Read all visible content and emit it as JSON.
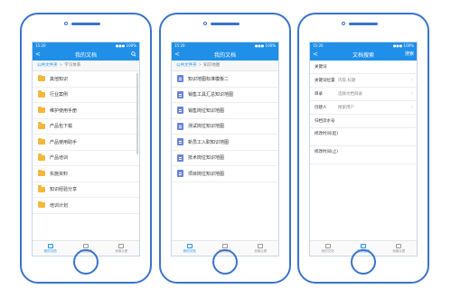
{
  "status_bar": {
    "left": "15:20",
    "right": "●●● 100%"
  },
  "screen1": {
    "title": "我的文档",
    "back": "<",
    "right_icon": "search-icon",
    "breadcrumb": {
      "root": "公共文件夹",
      "sep": ">",
      "current": "学习体系"
    },
    "items": [
      {
        "label": "其他知识"
      },
      {
        "label": "行业案例"
      },
      {
        "label": "维护使用手册"
      },
      {
        "label": "产品包下载"
      },
      {
        "label": "产品使用助手"
      },
      {
        "label": "产品培训"
      },
      {
        "label": "实施资料"
      },
      {
        "label": "知识经验分享"
      },
      {
        "label": "培训计划"
      }
    ]
  },
  "screen2": {
    "title": "我的文档",
    "back": "<",
    "breadcrumb": {
      "root": "公共文件夹",
      "sep": ">",
      "current": "知识地图"
    },
    "items": [
      {
        "label": "知识地图标准模板二"
      },
      {
        "label": "销售工具汇总知识地图"
      },
      {
        "label": "销售岗位知识地图"
      },
      {
        "label": "测试岗位知识地图"
      },
      {
        "label": "新员工入职知识地图"
      },
      {
        "label": "技术岗位知识地图"
      },
      {
        "label": "项目岗位知识地图"
      }
    ]
  },
  "screen3": {
    "title": "文档搜索",
    "back": "<",
    "right_label": "搜索",
    "fields": [
      {
        "label": "关键词",
        "value": ""
      },
      {
        "label": "关键词位置",
        "value": "内容,标题"
      },
      {
        "label": "目录",
        "value": "选择文档目录"
      },
      {
        "label": "创建人",
        "value": "搜索用户"
      },
      {
        "label": "归档流水号",
        "value": ""
      },
      {
        "label": "修改时间(起)",
        "value": ""
      },
      {
        "label": "修改时间(止)",
        "value": ""
      }
    ]
  },
  "tabs": [
    {
      "label": "我的文档"
    },
    {
      "label": "文档搜索"
    },
    {
      "label": "我最近看"
    }
  ],
  "colors": {
    "accent": "#1f8fe8",
    "folder": "#f4b73d",
    "doc": "#6b84d6",
    "frame": "#3a73c9"
  }
}
